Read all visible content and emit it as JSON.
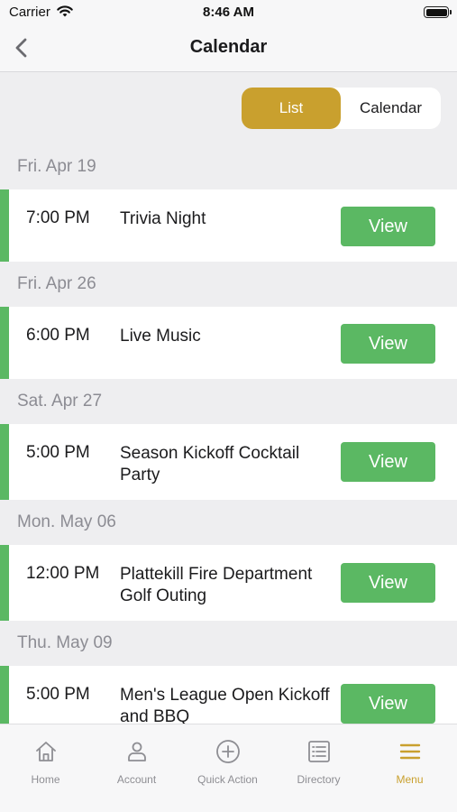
{
  "status_bar": {
    "carrier": "Carrier",
    "time": "8:46 AM"
  },
  "nav": {
    "title": "Calendar"
  },
  "segment": {
    "list_label": "List",
    "calendar_label": "Calendar",
    "selected": "List"
  },
  "days": [
    {
      "date": "Fri. Apr 19",
      "events": [
        {
          "time": "7:00 PM",
          "title": "Trivia Night",
          "action": "View"
        }
      ]
    },
    {
      "date": "Fri. Apr 26",
      "events": [
        {
          "time": "6:00 PM",
          "title": "Live Music",
          "action": "View"
        }
      ]
    },
    {
      "date": "Sat. Apr 27",
      "events": [
        {
          "time": "5:00 PM",
          "title": "Season Kickoff Cocktail Party",
          "action": "View"
        }
      ]
    },
    {
      "date": "Mon. May 06",
      "events": [
        {
          "time": "12:00 PM",
          "title": "Plattekill Fire Department Golf Outing",
          "action": "View"
        }
      ]
    },
    {
      "date": "Thu. May 09",
      "events": [
        {
          "time": "5:00 PM",
          "title": "Men's League Open Kickoff and BBQ",
          "action": "View"
        }
      ]
    }
  ],
  "tab_bar": {
    "items": [
      {
        "label": "Home",
        "icon": "home-icon"
      },
      {
        "label": "Account",
        "icon": "person-icon"
      },
      {
        "label": "Quick Action",
        "icon": "plus-circle-icon"
      },
      {
        "label": "Directory",
        "icon": "list-icon"
      },
      {
        "label": "Menu",
        "icon": "menu-icon"
      }
    ],
    "active": "Menu"
  },
  "colors": {
    "accent": "#c9a02e",
    "view_button": "#5bb863",
    "event_marker": "#5bb863",
    "day_header_text": "#8c8c93"
  }
}
